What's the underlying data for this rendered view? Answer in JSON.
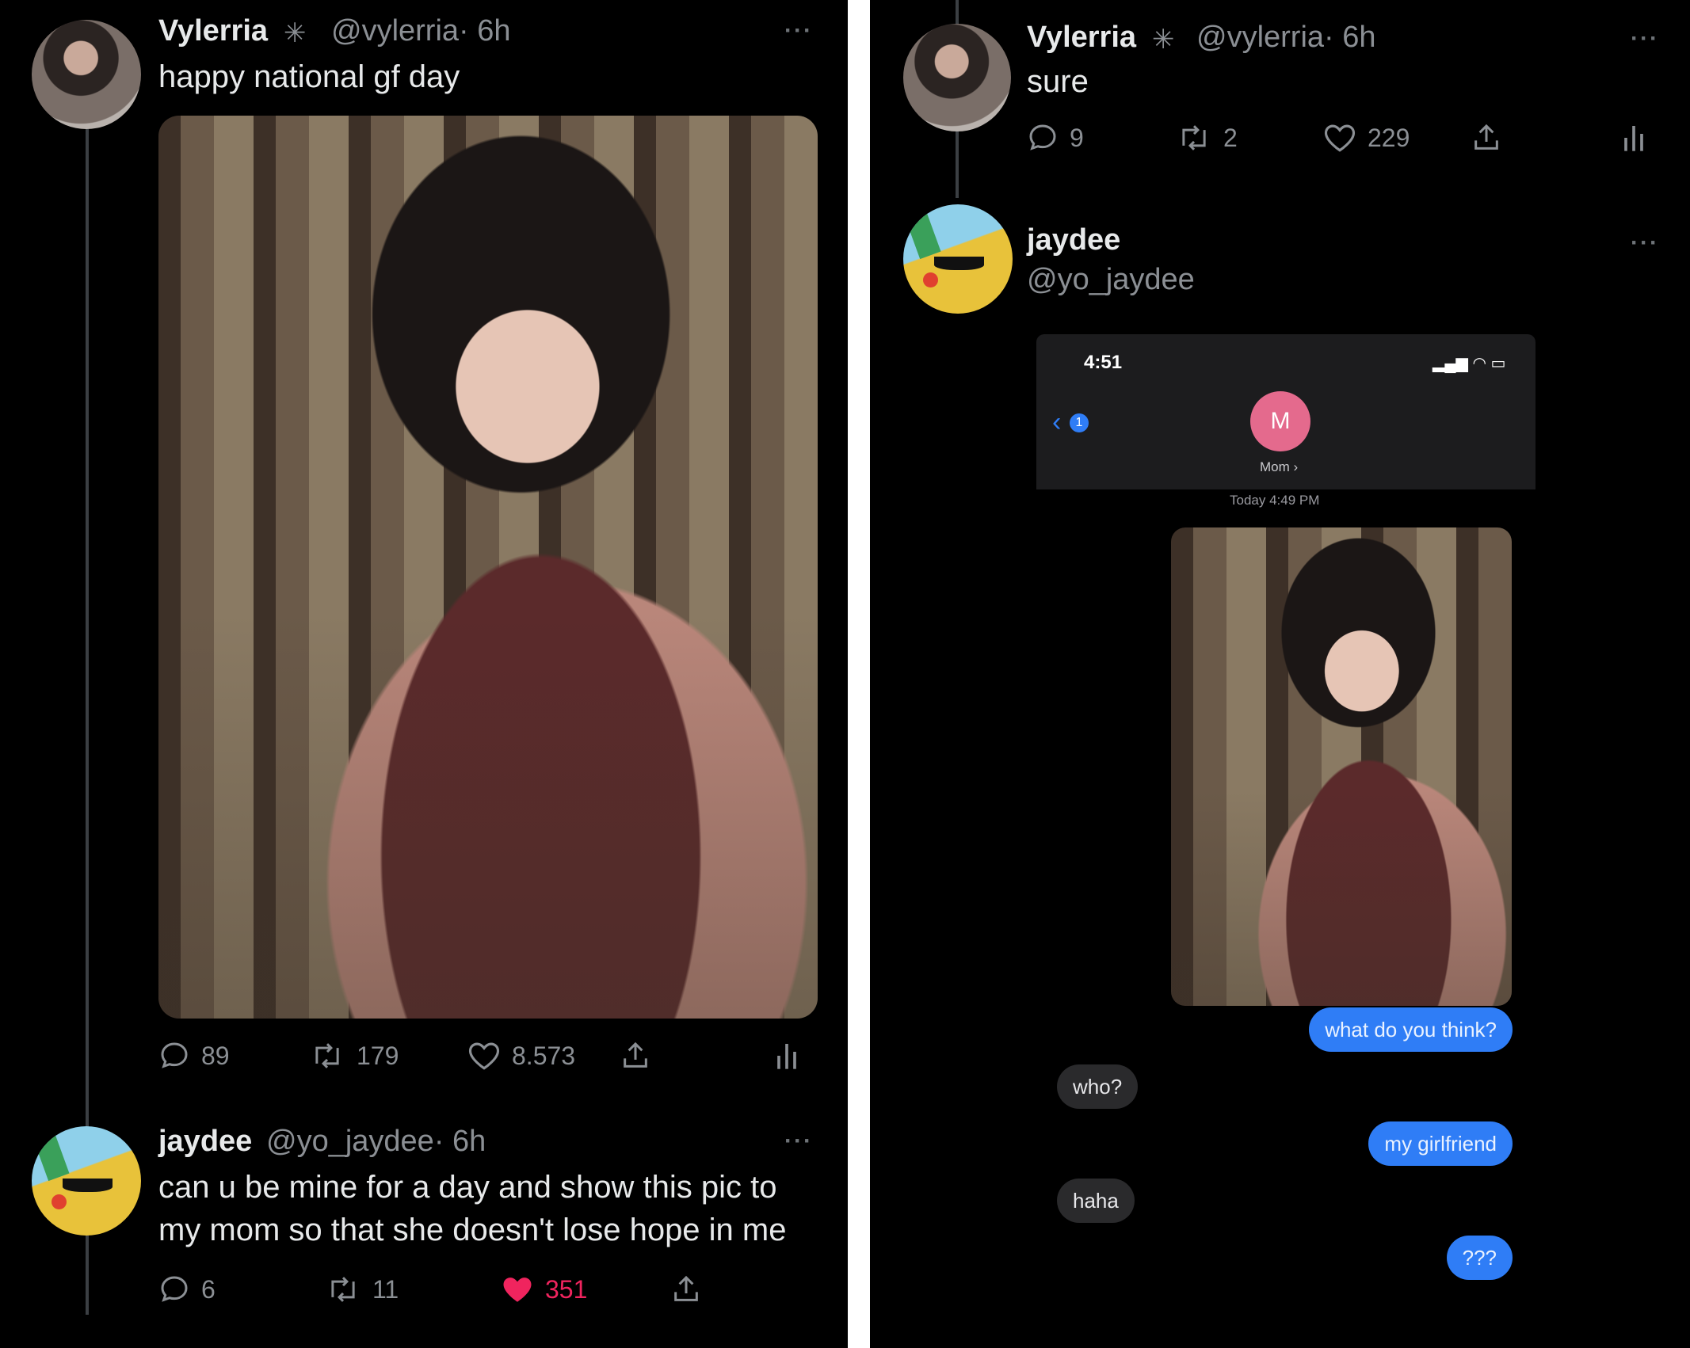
{
  "left_panel": {
    "tweet": {
      "author_name": "Vylerria",
      "author_handle": "@vylerria",
      "time": "· 6h",
      "text": "happy national gf day",
      "stats": {
        "replies": "89",
        "retweets": "179",
        "likes": "8.573"
      }
    },
    "reply": {
      "author_name": "jaydee",
      "author_handle": "@yo_jaydee",
      "time": "· 6h",
      "text_line1": "can u be mine for a day and show this pic to",
      "text_line2": "my mom so that she doesn't lose hope in me",
      "stats": {
        "replies": "6",
        "retweets": "11",
        "likes": "351"
      }
    }
  },
  "right_panel": {
    "tweet": {
      "author_name": "Vylerria",
      "author_handle": "@vylerria",
      "time": "· 6h",
      "text": "sure",
      "stats": {
        "replies": "9",
        "retweets": "2",
        "likes": "229"
      }
    },
    "reply": {
      "author_name": "jaydee",
      "author_handle": "@yo_jaydee"
    },
    "imessage": {
      "status_time": "4:51",
      "contact_initial": "M",
      "contact_name": "Mom ›",
      "back_count": "1",
      "timestamp": "Today 4:49 PM",
      "messages": [
        {
          "from": "me",
          "text": "what do you think?"
        },
        {
          "from": "them",
          "text": "who?"
        },
        {
          "from": "me",
          "text": "my girlfriend"
        },
        {
          "from": "them",
          "text": "haha"
        },
        {
          "from": "me",
          "text": "???"
        }
      ]
    }
  },
  "colors": {
    "background": "#000000",
    "text_primary": "#e7e9ea",
    "text_secondary": "#8b8f94",
    "like_active": "#f0245e",
    "imessage_blue": "#2f7df6",
    "imessage_gray": "#2a2a2c"
  }
}
